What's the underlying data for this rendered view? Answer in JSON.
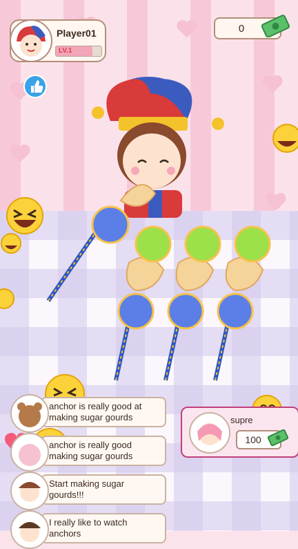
{
  "player": {
    "name": "Player01",
    "level": "LV.1",
    "level_progress": 0.8
  },
  "coins": {
    "value": "0"
  },
  "customer": {
    "name": "supre",
    "price": "100"
  },
  "chat": [
    {
      "text": "anchor is really good at making sugar gourds"
    },
    {
      "text": "anchor is really good making sugar gourds"
    },
    {
      "text": "Start making sugar gourds!!!"
    },
    {
      "text": "I really like to watch anchors"
    }
  ],
  "icons": [
    "thumbs-up-icon",
    "money-icon",
    "laughing-emoji-icon",
    "kiss-emoji-icon",
    "heart-icon"
  ],
  "colors": {
    "accent_pink": "#c23f7a",
    "card_border": "#b38d7a",
    "table_check": "#d2c8eb"
  }
}
